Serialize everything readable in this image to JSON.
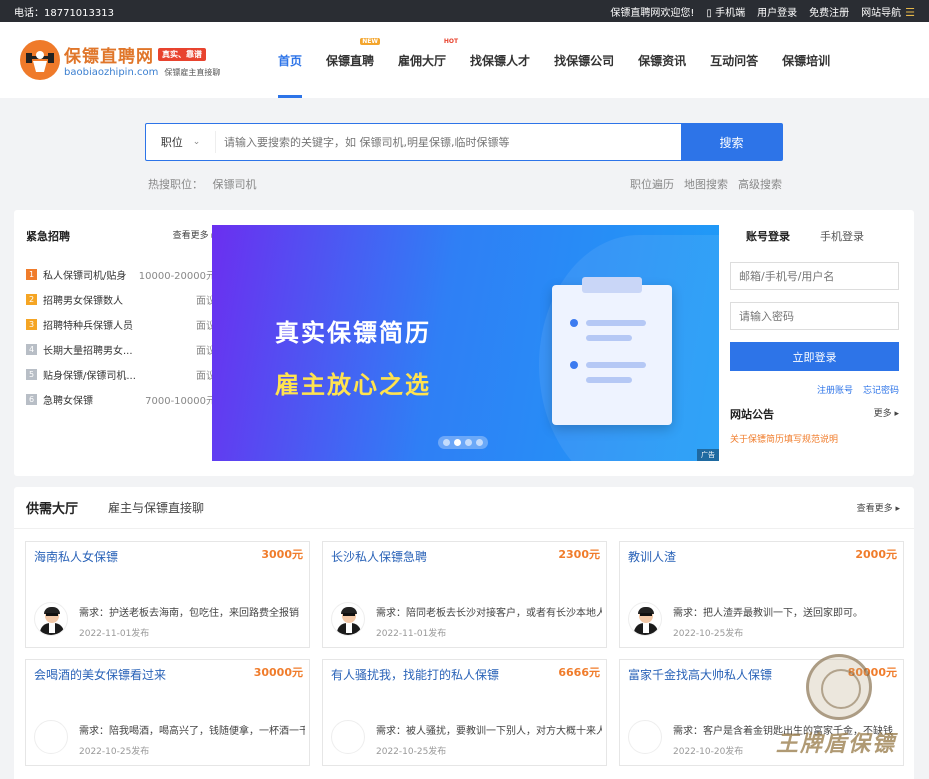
{
  "topbar": {
    "phone": "电话：18771013313",
    "welcome": "保镖直聘网欢迎您!",
    "mobile": "手机端",
    "login": "用户登录",
    "register": "免费注册",
    "sitenav": "网站导航"
  },
  "logo": {
    "cn": "保镖直聘网",
    "tag": "真实、靠谱",
    "en": "baobiaozhipin.com",
    "slogan": "保镖雇主直接聊"
  },
  "nav": [
    {
      "label": "首页",
      "active": true,
      "badge": ""
    },
    {
      "label": "保镖直聘",
      "badge": "NEW"
    },
    {
      "label": "雇佣大厅",
      "badge": "HOT"
    },
    {
      "label": "找保镖人才",
      "badge": ""
    },
    {
      "label": "找保镖公司",
      "badge": ""
    },
    {
      "label": "保镖资讯",
      "badge": ""
    },
    {
      "label": "互动问答",
      "badge": ""
    },
    {
      "label": "保镖培训",
      "badge": ""
    }
  ],
  "search": {
    "type": "职位",
    "placeholder": "请输入要搜索的关键字，如 保镖司机,明星保镖,临时保镖等",
    "button": "搜索",
    "hot_label": "热搜职位：",
    "hot_item": "保镖司机",
    "links": [
      "职位遍历",
      "地图搜索",
      "高级搜索"
    ]
  },
  "urgent": {
    "title": "紧急招聘",
    "more": "查看更多",
    "items": [
      {
        "num": "1",
        "title": "私人保镖司机/贴身",
        "salary": "10000-20000元"
      },
      {
        "num": "2",
        "title": "招聘男女保镖数人",
        "salary": "面议"
      },
      {
        "num": "3",
        "title": "招聘特种兵保镖人员",
        "salary": "面议"
      },
      {
        "num": "4",
        "title": "长期大量招聘男女...",
        "salary": "面议"
      },
      {
        "num": "5",
        "title": "贴身保镖/保镖司机...",
        "salary": "面议"
      },
      {
        "num": "6",
        "title": "急聘女保镖",
        "salary": "7000-10000元"
      }
    ]
  },
  "banner": {
    "line1": "真实保镖简历",
    "line2": "雇主放心之选",
    "ad": "广告"
  },
  "login": {
    "tab_account": "账号登录",
    "tab_phone": "手机登录",
    "user_placeholder": "邮箱/手机号/用户名",
    "pwd_placeholder": "请输入密码",
    "button": "立即登录",
    "register": "注册账号",
    "forgot": "忘记密码",
    "notice_title": "网站公告",
    "notice_more": "更多",
    "notice_item": "关于保镖简历填写规范说明"
  },
  "supply": {
    "title": "供需大厅",
    "subtitle": "雇主与保镖直接聊",
    "more": "查看更多",
    "cards": [
      {
        "title": "海南私人女保镖",
        "price": "3000元",
        "need": "需求：护送老板去海南，包吃住，来回路费全报销",
        "date": "2022-11-01发布",
        "avatar": true
      },
      {
        "title": "长沙私人保镖急聘",
        "price": "2300元",
        "need": "需求：陪同老板去长沙对接客户，或者有长沙本地人",
        "date": "2022-11-01发布",
        "avatar": true
      },
      {
        "title": "教训人渣",
        "price": "2000元",
        "need": "需求：把人渣弄最教训一下，送回家即可。",
        "date": "2022-10-25发布",
        "avatar": true
      },
      {
        "title": "会喝酒的美女保镖看过来",
        "price": "30000元",
        "need": "需求：陪我喝酒，喝高兴了，钱随便拿，一杯酒一千",
        "date": "2022-10-25发布",
        "avatar": false
      },
      {
        "title": "有人骚扰我，找能打的私人保镖",
        "price": "6666元",
        "need": "需求：被人骚扰，要教训一下别人，对方大概十来人",
        "date": "2022-10-25发布",
        "avatar": false
      },
      {
        "title": "富家千金找高大帅私人保镖",
        "price": "80000元",
        "need": "需求：客户是含着金钥匙出生的富家千金，不缺钱",
        "date": "2022-10-20发布",
        "avatar": false
      }
    ]
  },
  "watermark": "王牌盾保镖",
  "colors": {
    "primary": "#2d74e8",
    "accent": "#f07c2b",
    "topbar": "#2a2d33"
  }
}
